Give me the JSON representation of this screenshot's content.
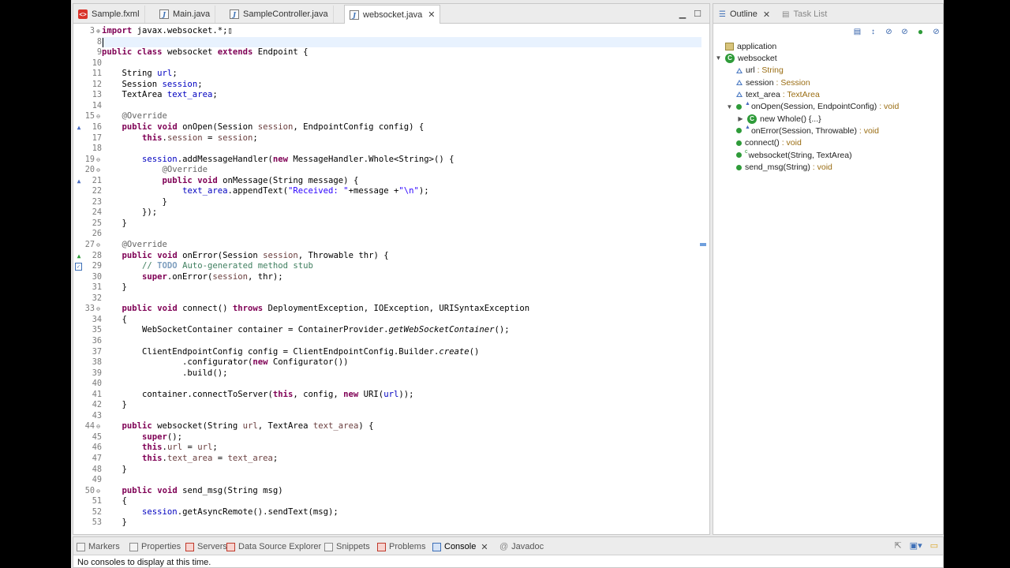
{
  "editor": {
    "tabs": [
      {
        "label": "Sample.fxml",
        "icon": "xml-file-icon",
        "active": false
      },
      {
        "label": "Main.java",
        "icon": "java-file-icon",
        "active": false
      },
      {
        "label": "SampleController.java",
        "icon": "java-file-icon",
        "active": false
      },
      {
        "label": "websocket.java",
        "icon": "java-file-icon",
        "active": true
      }
    ],
    "lines": [
      {
        "n": "3",
        "text": "import javax.websocket.*;▯",
        "fold": "+"
      },
      {
        "n": "8",
        "text": ""
      },
      {
        "n": "9",
        "text": "public class websocket extends Endpoint {"
      },
      {
        "n": "10",
        "text": ""
      },
      {
        "n": "11",
        "text": "    String url;"
      },
      {
        "n": "12",
        "text": "    Session session;"
      },
      {
        "n": "13",
        "text": "    TextArea text_area;"
      },
      {
        "n": "14",
        "text": ""
      },
      {
        "n": "15",
        "text": "    @Override",
        "fold": "-"
      },
      {
        "n": "16",
        "text": "    public void onOpen(Session session, EndpointConfig config) {",
        "marker": "override"
      },
      {
        "n": "17",
        "text": "        this.session = session;"
      },
      {
        "n": "18",
        "text": ""
      },
      {
        "n": "19",
        "text": "        session.addMessageHandler(new MessageHandler.Whole<String>() {",
        "fold": "-"
      },
      {
        "n": "20",
        "text": "            @Override",
        "fold": "-"
      },
      {
        "n": "21",
        "text": "            public void onMessage(String message) {",
        "marker": "override"
      },
      {
        "n": "22",
        "text": "                text_area.appendText(\"Received: \"+message +\"\\n\");"
      },
      {
        "n": "23",
        "text": "            }"
      },
      {
        "n": "24",
        "text": "        });"
      },
      {
        "n": "25",
        "text": "    }"
      },
      {
        "n": "26",
        "text": ""
      },
      {
        "n": "27",
        "text": "    @Override",
        "fold": "-"
      },
      {
        "n": "28",
        "text": "    public void onError(Session session, Throwable thr) {",
        "marker": "implement"
      },
      {
        "n": "29",
        "text": "        // TODO Auto-generated method stub",
        "marker": "task"
      },
      {
        "n": "30",
        "text": "        super.onError(session, thr);"
      },
      {
        "n": "31",
        "text": "    }"
      },
      {
        "n": "32",
        "text": ""
      },
      {
        "n": "33",
        "text": "    public void connect() throws DeploymentException, IOException, URISyntaxException",
        "fold": "-"
      },
      {
        "n": "34",
        "text": "    {"
      },
      {
        "n": "35",
        "text": "        WebSocketContainer container = ContainerProvider.getWebSocketContainer();"
      },
      {
        "n": "36",
        "text": ""
      },
      {
        "n": "37",
        "text": "        ClientEndpointConfig config = ClientEndpointConfig.Builder.create()"
      },
      {
        "n": "38",
        "text": "                .configurator(new Configurator())"
      },
      {
        "n": "39",
        "text": "                .build();"
      },
      {
        "n": "40",
        "text": ""
      },
      {
        "n": "41",
        "text": "        container.connectToServer(this, config, new URI(url));"
      },
      {
        "n": "42",
        "text": "    }"
      },
      {
        "n": "43",
        "text": ""
      },
      {
        "n": "44",
        "text": "    public websocket(String url, TextArea text_area) {",
        "fold": "-"
      },
      {
        "n": "45",
        "text": "        super();"
      },
      {
        "n": "46",
        "text": "        this.url = url;"
      },
      {
        "n": "47",
        "text": "        this.text_area = text_area;"
      },
      {
        "n": "48",
        "text": "    }"
      },
      {
        "n": "49",
        "text": ""
      },
      {
        "n": "50",
        "text": "    public void send_msg(String msg)",
        "fold": "-"
      },
      {
        "n": "51",
        "text": "    {"
      },
      {
        "n": "52",
        "text": "        session.getAsyncRemote().sendText(msg);"
      },
      {
        "n": "53",
        "text": "    }"
      }
    ]
  },
  "outline": {
    "tabs": [
      {
        "label": "Outline",
        "icon": "outline-icon",
        "active": true
      },
      {
        "label": "Task List",
        "icon": "task-list-icon",
        "active": false
      }
    ],
    "toolbar": [
      "collapse-all-icon",
      "sort-icon",
      "hide-fields-icon",
      "hide-static-icon",
      "hide-nonpublic-icon",
      "hide-local-types-icon"
    ],
    "items": [
      {
        "name": "application",
        "type": "",
        "kind": "package",
        "depth": 0,
        "twisty": ""
      },
      {
        "name": "websocket",
        "type": "",
        "kind": "class",
        "depth": 0,
        "twisty": "▼"
      },
      {
        "name": "url",
        "type": " : String",
        "kind": "field",
        "depth": 1,
        "twisty": ""
      },
      {
        "name": "session",
        "type": " : Session",
        "kind": "field",
        "depth": 1,
        "twisty": ""
      },
      {
        "name": "text_area",
        "type": " : TextArea",
        "kind": "field",
        "depth": 1,
        "twisty": ""
      },
      {
        "name": "onOpen(Session, EndpointConfig)",
        "type": " : void",
        "kind": "method-override",
        "depth": 1,
        "twisty": "▼"
      },
      {
        "name": "new Whole() {...}",
        "type": "",
        "kind": "anon-class",
        "depth": 2,
        "twisty": "▶"
      },
      {
        "name": "onError(Session, Throwable)",
        "type": " : void",
        "kind": "method-override",
        "depth": 1,
        "twisty": ""
      },
      {
        "name": "connect()",
        "type": " : void",
        "kind": "method",
        "depth": 1,
        "twisty": ""
      },
      {
        "name": "websocket(String, TextArea)",
        "type": "",
        "kind": "constructor",
        "depth": 1,
        "twisty": ""
      },
      {
        "name": "send_msg(String)",
        "type": " : void",
        "kind": "method",
        "depth": 1,
        "twisty": ""
      }
    ]
  },
  "bottom": {
    "tabs": [
      {
        "label": "Markers",
        "active": false
      },
      {
        "label": "Properties",
        "active": false
      },
      {
        "label": "Servers",
        "active": false
      },
      {
        "label": "Data Source Explorer",
        "active": false
      },
      {
        "label": "Snippets",
        "active": false
      },
      {
        "label": "Problems",
        "active": false
      },
      {
        "label": "Console",
        "active": true
      },
      {
        "label": "Javadoc",
        "active": false
      }
    ],
    "console_message": "No consoles to display at this time."
  }
}
